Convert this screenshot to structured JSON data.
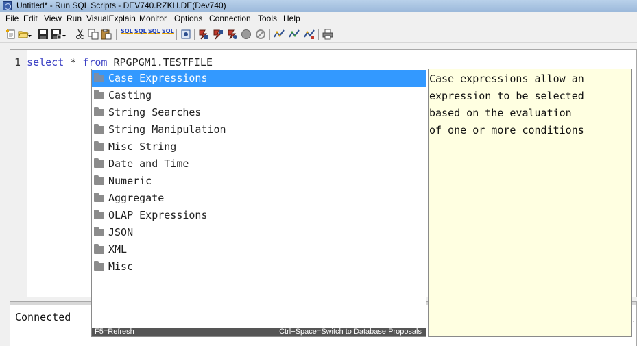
{
  "window": {
    "title": "Untitled* - Run SQL Scripts - DEV740.RZKH.DE(Dev740)"
  },
  "menu": {
    "items": [
      "File",
      "Edit",
      "View",
      "Run",
      "VisualExplain",
      "Monitor",
      "Options",
      "Connection",
      "Tools",
      "Help"
    ]
  },
  "toolbar": {
    "icons": [
      "new-script-icon",
      "open-icon",
      "save-icon",
      "save-as-icon",
      "cut-icon",
      "copy-icon",
      "paste-icon",
      "run-all-icon",
      "run-from-selected-icon",
      "run-selected-icon",
      "run-next-icon",
      "jdbc-settings-icon",
      "explain-icon",
      "run-and-explain-icon",
      "visual-explain-icon",
      "stop-icon",
      "cancel-icon",
      "monitor-start-icon",
      "monitor-icon",
      "monitor-stop-icon",
      "print-icon"
    ],
    "sql_label": "SQL"
  },
  "editor": {
    "line_number": "1",
    "code": {
      "kw1": "select",
      "star": " * ",
      "kw2": "from",
      "table": " RPGPGM1.TESTFILE"
    }
  },
  "content_assist": {
    "items": [
      "Case Expressions",
      "Casting",
      "String Searches",
      "String Manipulation",
      "Misc String",
      "Date and Time",
      "Numeric",
      "Aggregate",
      "OLAP Expressions",
      "JSON",
      "XML",
      "Misc"
    ],
    "selected_index": 0,
    "footer_left": "F5=Refresh",
    "footer_right": "Ctrl+Space=Switch to Database Proposals",
    "description": "Case expressions allow an\nexpression to be selected\nbased on the evaluation\nof one or more conditions"
  },
  "messages": {
    "status": "Connected"
  }
}
